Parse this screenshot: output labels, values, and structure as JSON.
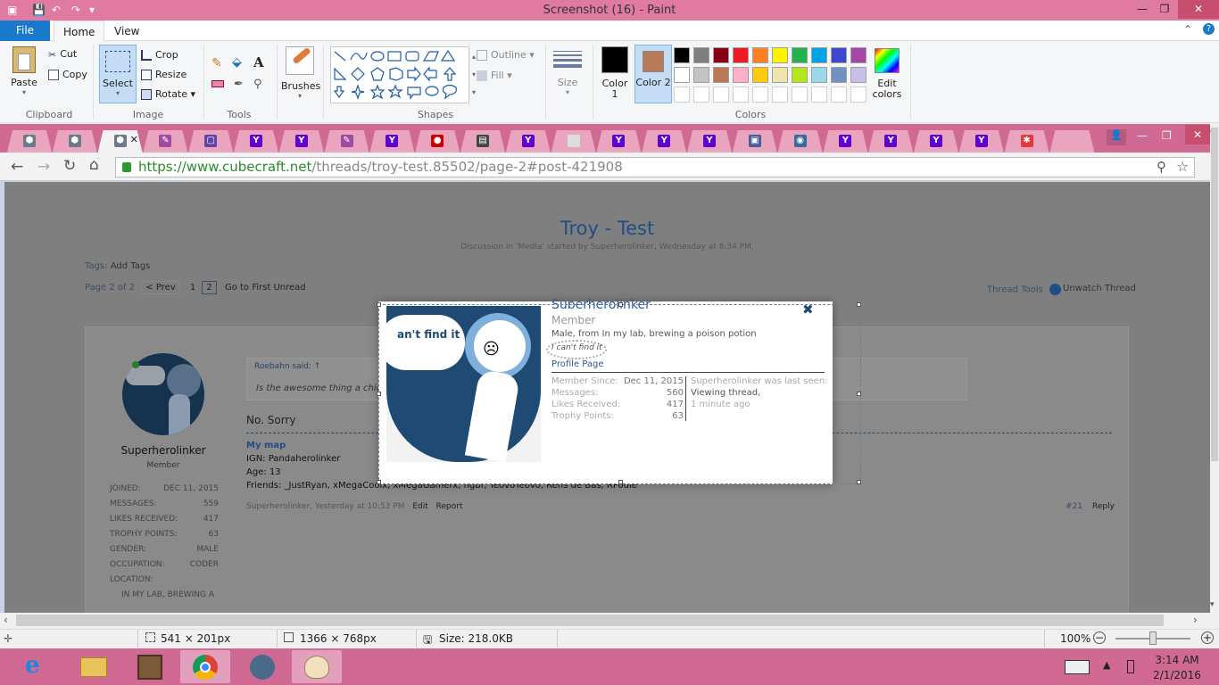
{
  "window": {
    "title": "Screenshot (16) - Paint",
    "minimize": "—",
    "restore": "❐",
    "close": "✕"
  },
  "menu": {
    "file": "File",
    "home": "Home",
    "view": "View"
  },
  "ribbon": {
    "clipboard": {
      "label": "Clipboard",
      "paste": "Paste",
      "cut": "Cut",
      "copy": "Copy"
    },
    "image": {
      "label": "Image",
      "select": "Select",
      "crop": "Crop",
      "resize": "Resize",
      "rotate": "Rotate"
    },
    "tools": {
      "label": "Tools"
    },
    "brushes": {
      "label": "Brushes"
    },
    "shapes": {
      "label": "Shapes",
      "outline": "Outline",
      "fill": "Fill"
    },
    "size": {
      "label": "Size"
    },
    "colors": {
      "label": "Colors",
      "color1": "Color 1",
      "color2": "Color 2",
      "edit": "Edit colors",
      "color1_value": "#000000",
      "color2_value": "#b97a57",
      "palette_row1": [
        "#000000",
        "#7f7f7f",
        "#880015",
        "#ed1c24",
        "#ff7f27",
        "#fff200",
        "#22b14c",
        "#00a2e8",
        "#3f48cc",
        "#a349a4"
      ],
      "palette_row2": [
        "#ffffff",
        "#c3c3c3",
        "#b97a57",
        "#ffaec9",
        "#ffc90e",
        "#efe4b0",
        "#b5e61d",
        "#99d9ea",
        "#7092be",
        "#c8bfe7"
      ]
    }
  },
  "browser": {
    "url_host": "https://www.cubecraft.net",
    "url_path": "/threads/troy-test.85502/page-2#post-421908",
    "tab_icons": [
      "cube",
      "cube",
      "cube",
      "feather",
      "twitch",
      "yahoo",
      "yahoo",
      "feather",
      "yahoo",
      "record",
      "bbc",
      "yahoo",
      "doc",
      "yahoo",
      "yahoo",
      "yahoo",
      "img",
      "eye",
      "yahoo",
      "yahoo",
      "yahoo",
      "yahoo",
      "gear",
      "blank"
    ]
  },
  "page": {
    "title": "Troy - Test",
    "subtitle": "Discussion in 'Media' started by Superherolinker, Wednesday at 8:34 PM.",
    "tags_label": "Tags:",
    "tags_value": "Add Tags",
    "pager": {
      "of": "Page 2 of 2",
      "prev": "< Prev",
      "p1": "1",
      "p2": "2",
      "first_unread": "Go to First Unread"
    },
    "thread_tools": "Thread Tools",
    "unwatch": "Unwatch Thread",
    "author": {
      "name": "Superherolinker",
      "role": "Member",
      "stats": [
        {
          "k": "JOINED:",
          "v": "DEC 11, 2015"
        },
        {
          "k": "MESSAGES:",
          "v": "559"
        },
        {
          "k": "LIKES RECEIVED:",
          "v": "417"
        },
        {
          "k": "TROPHY POINTS:",
          "v": "63"
        },
        {
          "k": "GENDER:",
          "v": "MALE"
        },
        {
          "k": "OCCUPATION:",
          "v": "CODER"
        },
        {
          "k": "LOCATION:",
          "v": ""
        }
      ],
      "location_value": "IN MY LAB, BREWING A"
    },
    "quote_author": "Roebahn said: ↑",
    "quote_text": "Is the awesome thing a chick",
    "reply": "No. Sorry",
    "sig": {
      "my_map": "My map",
      "ign": "IGN: Pandaherolinker",
      "age": "Age: 13",
      "friends": "Friends: _JustRyan, xMegaCoolx, xMegaGamerx, hgbf, TeovoTeovo, Rens de Bas, RPoule"
    },
    "footer": {
      "meta": "Superherolinker, Yesterday at 10:53 PM",
      "edit": "Edit",
      "report": "Report",
      "num": "#21",
      "reply": "Reply"
    }
  },
  "popup": {
    "bubble_text": "an't find it",
    "name": "Superherolinker",
    "role": "Member",
    "bio": "Male, from In my lab, brewing a poison potion",
    "status": "I can't find it",
    "profile_link": "Profile Page",
    "stats": [
      {
        "k": "Member Since:",
        "v": "Dec 11, 2015"
      },
      {
        "k": "Messages:",
        "v": "560"
      },
      {
        "k": "Likes Received:",
        "v": "417"
      },
      {
        "k": "Trophy Points:",
        "v": "63"
      }
    ],
    "last_seen_label": "Superherolinker was last seen:",
    "last_seen_action": "Viewing thread,",
    "last_seen_time": "1 minute ago"
  },
  "status": {
    "selection": "541 × 201px",
    "canvas": "1366 × 768px",
    "size": "Size: 218.0KB",
    "zoom": "100%"
  },
  "taskbar": {
    "time": "3:14 AM",
    "date": "2/1/2016"
  }
}
